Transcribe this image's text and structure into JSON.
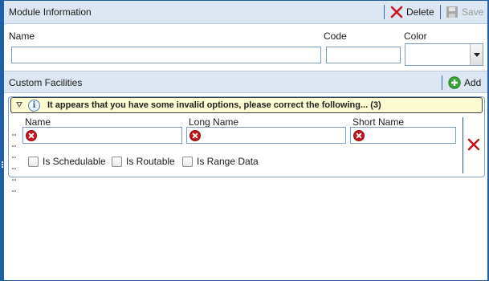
{
  "module": {
    "title": "Module Information",
    "delete_label": "Delete",
    "save_label": "Save",
    "fields": {
      "name_label": "Name",
      "name_value": "",
      "code_label": "Code",
      "code_value": "",
      "color_label": "Color",
      "color_value": ""
    }
  },
  "facilities": {
    "title": "Custom Facilities",
    "add_label": "Add",
    "warning_message": "It appears that you have some invalid options, please correct the following...  (3)",
    "item": {
      "name_label": "Name",
      "long_name_label": "Long Name",
      "short_name_label": "Short Name",
      "checkboxes": [
        "Is Schedulable",
        "Is Routable",
        "Is Range Data"
      ]
    }
  },
  "colors": {
    "accent": "#1f5fa8",
    "header_bg": "#dde7f3",
    "error": "#c4161c",
    "add_green": "#3aa33a",
    "warning_bg": "#fdfbd1"
  }
}
